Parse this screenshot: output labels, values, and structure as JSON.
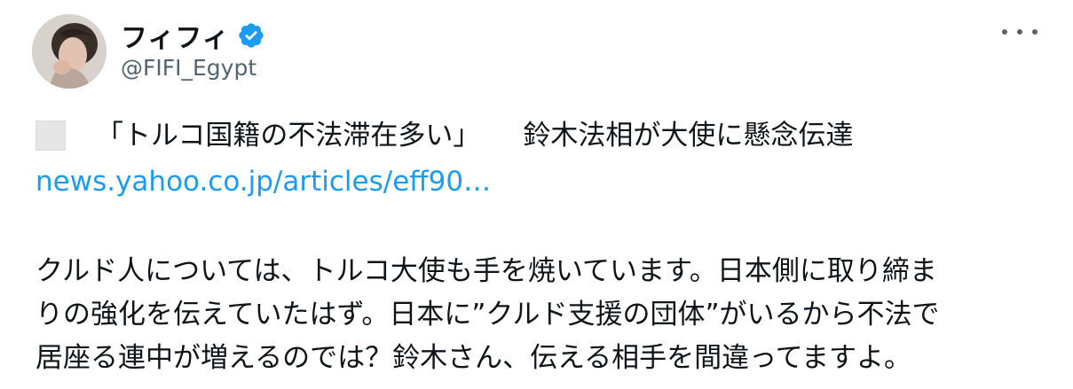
{
  "author": {
    "display_name": "フィフィ",
    "handle": "@FIFI_Egypt",
    "verified": true,
    "badge_color": "#1d9bf0"
  },
  "more_icon": "more-horizontal-icon",
  "headline": {
    "part1": "「トルコ国籍の不法滞在多い」",
    "part2": "鈴木法相が大使に懸念伝達"
  },
  "link": {
    "text": "news.yahoo.co.jp/articles/eff90…",
    "color": "#1d9bf0"
  },
  "body_lines": [
    "クルド人については、トルコ大使も手を焼いています。日本側に取り締ま",
    "りの強化を伝えていたはず。日本に”クルド支援の団体”がいるから不法で",
    "居座る連中が増えるのでは？鈴木さん、伝える相手を間違ってますよ。"
  ]
}
